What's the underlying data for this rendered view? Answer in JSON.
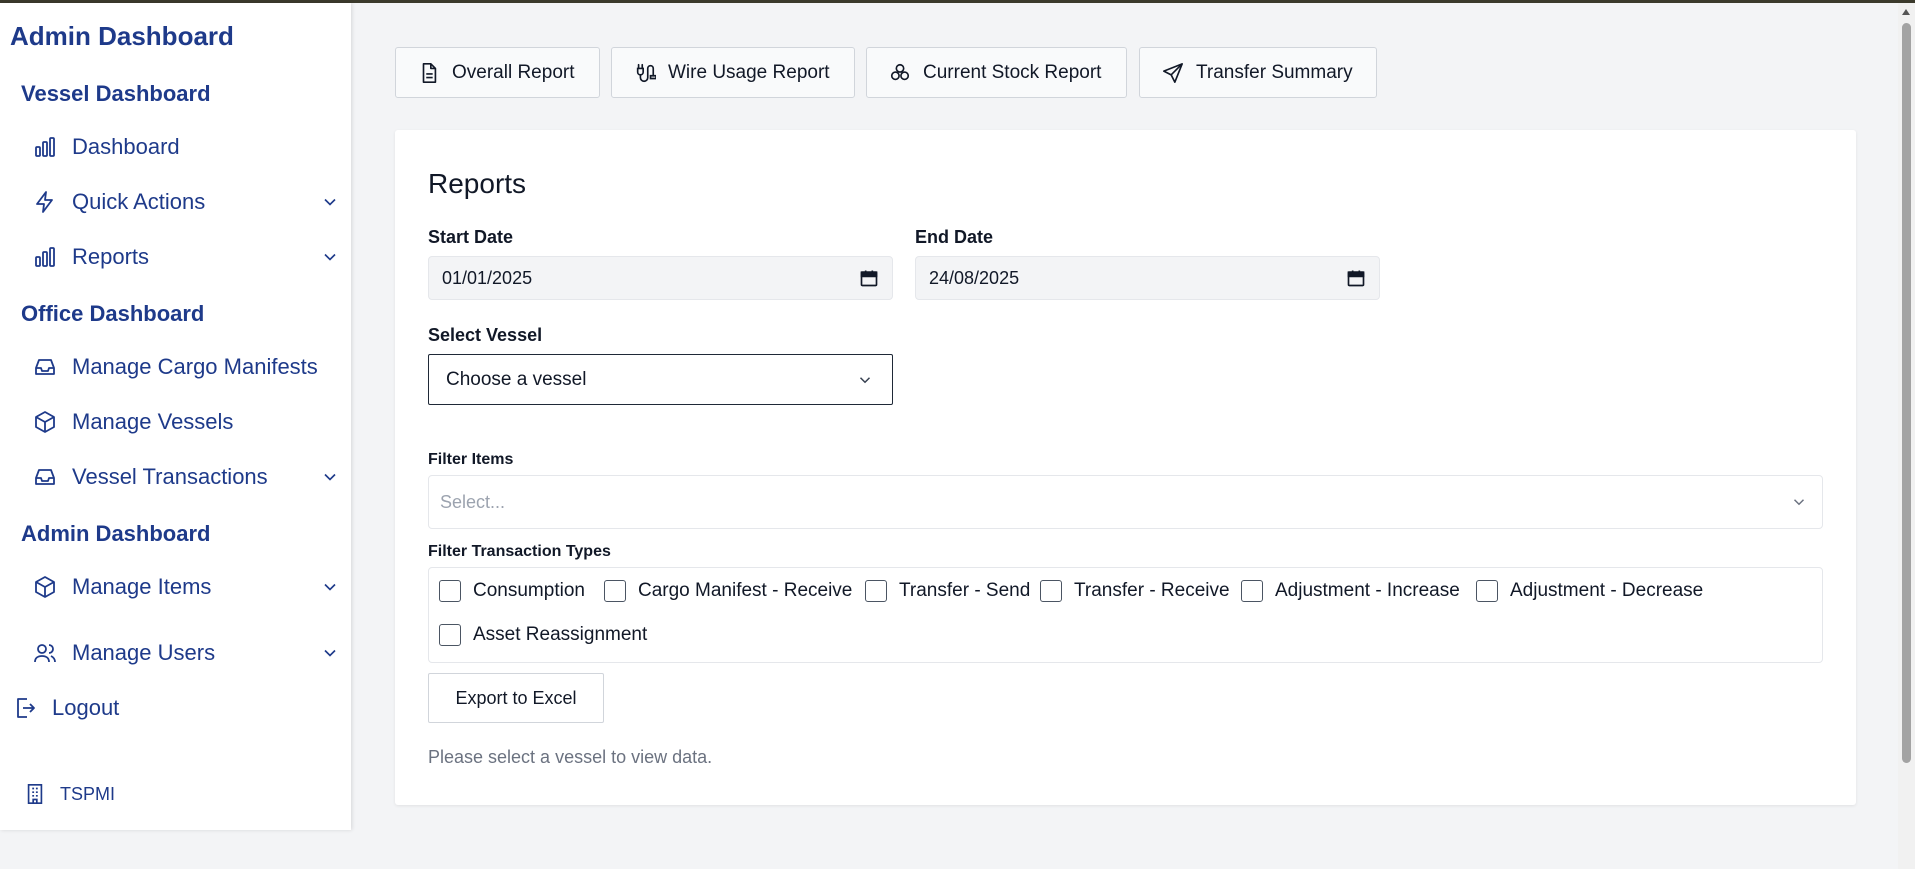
{
  "sidebar": {
    "brand": "Admin Dashboard",
    "sections": [
      {
        "title": "Vessel Dashboard"
      },
      {
        "title": "Office Dashboard"
      },
      {
        "title": "Admin Dashboard"
      }
    ],
    "items": [
      {
        "label": "Dashboard",
        "icon": "bar-chart-icon"
      },
      {
        "label": "Quick Actions",
        "icon": "lightning-icon"
      },
      {
        "label": "Reports",
        "icon": "bar-chart-icon"
      },
      {
        "label": "Manage Cargo Manifests",
        "icon": "inbox-icon"
      },
      {
        "label": "Manage Vessels",
        "icon": "box-icon"
      },
      {
        "label": "Vessel Transactions",
        "icon": "inbox-icon"
      },
      {
        "label": "Manage Items",
        "icon": "box-icon"
      },
      {
        "label": "Manage Users",
        "icon": "users-icon"
      },
      {
        "label": "Logout",
        "icon": "logout-icon"
      }
    ],
    "tenant": "TSPMI"
  },
  "report_buttons": [
    {
      "label": "Overall Report",
      "icon": "document-icon"
    },
    {
      "label": "Wire Usage Report",
      "icon": "cable-icon"
    },
    {
      "label": "Current Stock Report",
      "icon": "stack-icon"
    },
    {
      "label": "Transfer Summary",
      "icon": "send-icon"
    }
  ],
  "reports": {
    "title": "Reports",
    "start_date_label": "Start Date",
    "start_date_value": "01/01/2025",
    "end_date_label": "End Date",
    "end_date_value": "24/08/2025",
    "vessel_label": "Select Vessel",
    "vessel_value": "Choose a vessel",
    "filter_items_label": "Filter Items",
    "filter_items_placeholder": "Select...",
    "filter_types_label": "Filter Transaction Types",
    "transaction_types": [
      "Consumption",
      "Cargo Manifest - Receive",
      "Transfer - Send",
      "Transfer - Receive",
      "Adjustment - Increase",
      "Adjustment - Decrease",
      "Asset Reassignment"
    ],
    "export_label": "Export to Excel",
    "hint": "Please select a vessel to view data."
  },
  "colors": {
    "brand": "#1e3a8a",
    "background": "#f3f4f6"
  }
}
